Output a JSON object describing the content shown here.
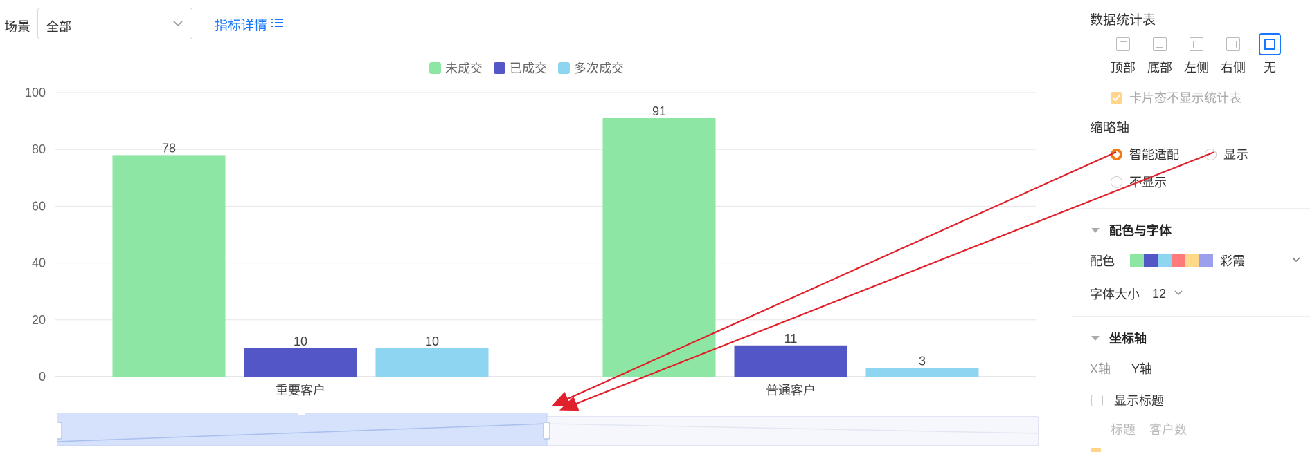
{
  "toolbar": {
    "scene_label": "场景",
    "scene_value": "全部",
    "metric_link": "指标详情"
  },
  "chart_data": {
    "type": "bar",
    "categories": [
      "重要客户",
      "普通客户"
    ],
    "series": [
      {
        "name": "未成交",
        "color": "#8ee6a4",
        "values": [
          78,
          91
        ]
      },
      {
        "name": "已成交",
        "color": "#5356c7",
        "values": [
          10,
          11
        ]
      },
      {
        "name": "多次成交",
        "color": "#8dd5f1",
        "values": [
          10,
          3
        ]
      }
    ],
    "ylim": [
      0,
      100
    ],
    "yticks": [
      "0",
      "20",
      "40",
      "60",
      "80",
      "100"
    ],
    "grid": true,
    "legend": "top-center"
  },
  "panel": {
    "stats_title": "数据统计表",
    "positions": [
      {
        "label": "顶部",
        "active": false
      },
      {
        "label": "底部",
        "active": false
      },
      {
        "label": "左侧",
        "active": false
      },
      {
        "label": "右侧",
        "active": false
      },
      {
        "label": "无",
        "active": true
      }
    ],
    "card_hide_label": "卡片态不显示统计表",
    "thumbnail_axis_title": "缩略轴",
    "thumb_options": [
      {
        "label": "智能适配",
        "checked": true
      },
      {
        "label": "显示",
        "checked": false
      },
      {
        "label": "不显示",
        "checked": false
      }
    ],
    "color_font_section": "配色与字体",
    "palette_label": "配色",
    "palette_name": "彩霞",
    "palette_colors": [
      "#8ee6a4",
      "#5356c7",
      "#8dd5f1",
      "#ff7a7a",
      "#ffd98a",
      "#9aa0ee"
    ],
    "font_size_label": "字体大小",
    "font_size_value": "12",
    "axis_section": "坐标轴",
    "axis_tabs": [
      "X轴",
      "Y轴"
    ],
    "show_title_label": "显示标题",
    "title_field_label": "标题",
    "title_field_value": "客户数"
  },
  "colors": {
    "accent": "#1677ff",
    "annotation_arrow": "#e0202a",
    "radio_checked": "#f07b12",
    "checkbox_disabled": "#ffd58a"
  }
}
